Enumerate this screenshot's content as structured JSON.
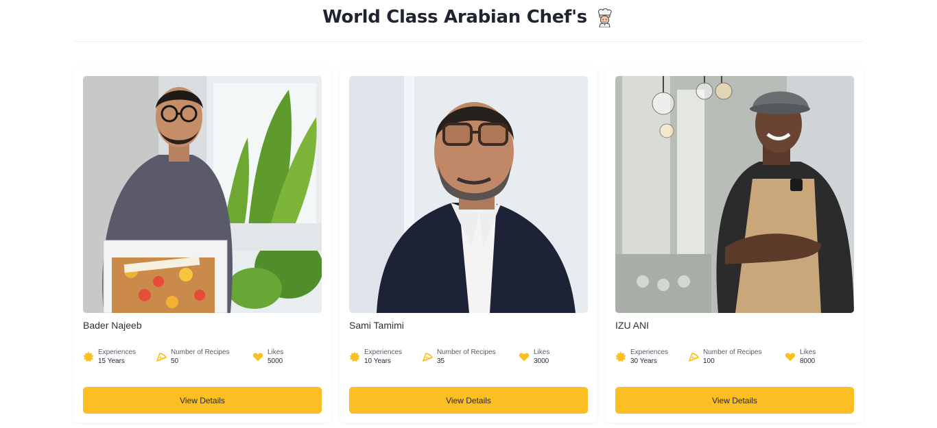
{
  "page": {
    "title": "World Class Arabian Chef's",
    "title_icon": "chef-emoji-icon"
  },
  "colors": {
    "accent": "#fbbf24",
    "text": "#1f2430"
  },
  "chefs": [
    {
      "name": "Bader Najeeb",
      "photo": "photo-man-holding-cake",
      "experience_label": "Experiences",
      "experience_value": "15 Years",
      "recipes_label": "Number of Recipes",
      "recipes_value": "50",
      "likes_label": "Likes",
      "likes_value": "5000",
      "button_label": "View Details"
    },
    {
      "name": "Sami Tamimi",
      "photo": "photo-man-glasses-cardigan",
      "experience_label": "Experiences",
      "experience_value": "10 Years",
      "recipes_label": "Number of Recipes",
      "recipes_value": "35",
      "likes_label": "Likes",
      "likes_value": "3000",
      "button_label": "View Details"
    },
    {
      "name": "IZU ANI",
      "photo": "photo-man-apron-restaurant",
      "experience_label": "Experiences",
      "experience_value": "30 Years",
      "recipes_label": "Number of Recipes",
      "recipes_value": "100",
      "likes_label": "Likes",
      "likes_value": "8000",
      "button_label": "View Details"
    }
  ]
}
